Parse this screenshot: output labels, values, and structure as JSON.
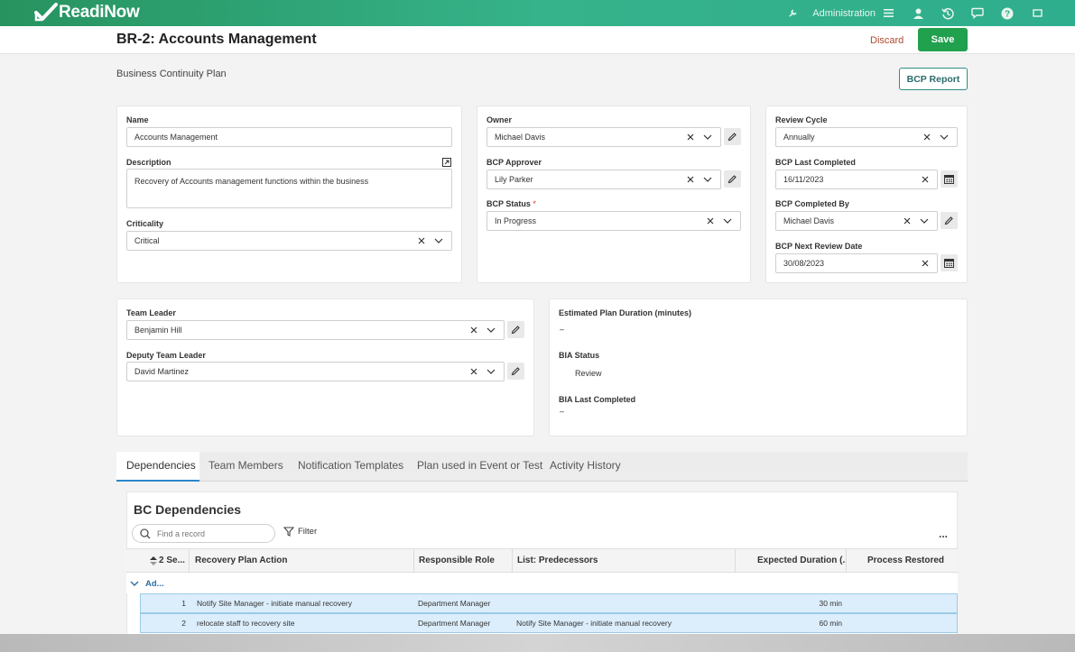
{
  "app": {
    "brand": "ReadiNow",
    "admin_label": "Administration"
  },
  "header": {
    "title": "BR-2: Accounts Management",
    "discard_label": "Discard",
    "save_label": "Save"
  },
  "plan_label": "Business Continuity Plan",
  "bcp_report_label": "BCP Report",
  "card1": {
    "name_label": "Name",
    "name_value": "Accounts Management",
    "description_label": "Description",
    "description_value": "Recovery of Accounts management functions within the business",
    "criticality_label": "Criticality",
    "criticality_value": "Critical"
  },
  "card2": {
    "owner_label": "Owner",
    "owner_value": "Michael Davis",
    "approver_label": "BCP Approver",
    "approver_value": "Lily Parker",
    "status_label": "BCP Status",
    "status_required": "*",
    "status_value": "In Progress"
  },
  "card3": {
    "review_cycle_label": "Review Cycle",
    "review_cycle_value": "Annually",
    "last_completed_label": "BCP Last Completed",
    "last_completed_value": "16/11/2023",
    "completed_by_label": "BCP Completed By",
    "completed_by_value": "Michael Davis",
    "next_review_label": "BCP Next Review Date",
    "next_review_value": "30/08/2023"
  },
  "card4": {
    "team_leader_label": "Team Leader",
    "team_leader_value": "Benjamin Hill",
    "deputy_label": "Deputy Team Leader",
    "deputy_value": "David Martinez"
  },
  "card5": {
    "duration_label": "Estimated Plan Duration (minutes)",
    "duration_value": "–",
    "bia_status_label": "BIA Status",
    "bia_status_value": "Review",
    "bia_last_label": "BIA Last Completed",
    "bia_last_value": "–"
  },
  "tabs": [
    {
      "label": "Dependencies"
    },
    {
      "label": "Team Members"
    },
    {
      "label": "Notification Templates"
    },
    {
      "label": "Plan used in Event or Test"
    },
    {
      "label": "Activity History"
    }
  ],
  "panel": {
    "title": "BC Dependencies",
    "search_placeholder": "Find a record",
    "filter_label": "Filter",
    "more_label": "..."
  },
  "table": {
    "columns": [
      "2 Se...",
      "Recovery Plan Action",
      "Responsible Role",
      "List: Predecessors",
      "Expected Duration (...",
      "Process Restored"
    ],
    "group_label": "Ad...",
    "rows": [
      {
        "seq": "1",
        "action": "Notify Site Manager - initiate manual recovery",
        "role": "Department Manager",
        "predecessors": "",
        "duration": "30 min",
        "restored": ""
      },
      {
        "seq": "2",
        "action": "relocate staff to recovery site",
        "role": "Department Manager",
        "predecessors": "Notify Site Manager - initiate manual recovery",
        "duration": "60 min",
        "restored": ""
      }
    ]
  },
  "colors": {
    "brand_green": "#2fae8e",
    "save_green": "#21a04e",
    "tab_active": "#2b87c9",
    "row_selected": "#dceefb"
  }
}
